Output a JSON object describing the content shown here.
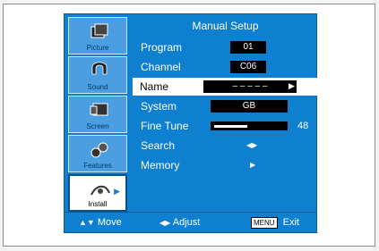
{
  "osd": {
    "title": "Manual Setup",
    "accent": "#0f7fd0",
    "sidebar": [
      {
        "label": "Picture",
        "icon": "picture-icon",
        "selected": false
      },
      {
        "label": "Sound",
        "icon": "sound-icon",
        "selected": false
      },
      {
        "label": "Screen",
        "icon": "screen-icon",
        "selected": false
      },
      {
        "label": "Features",
        "icon": "features-icon",
        "selected": false
      },
      {
        "label": "Install",
        "icon": "install-icon",
        "selected": true
      }
    ],
    "rows": [
      {
        "label": "Program",
        "value": "01"
      },
      {
        "label": "Channel",
        "value": "C06"
      },
      {
        "label": "Name",
        "value": "– – – – –"
      },
      {
        "label": "System",
        "value": "GB"
      },
      {
        "label": "Fine Tune",
        "value": "48",
        "level": 0.48
      },
      {
        "label": "Search",
        "glyph": "◀▶"
      },
      {
        "label": "Memory",
        "glyph": "▶"
      }
    ],
    "footer": {
      "move_label": "Move",
      "adjust_label": "Adjust",
      "exit_badge": "MENU",
      "exit_label": "Exit"
    }
  }
}
